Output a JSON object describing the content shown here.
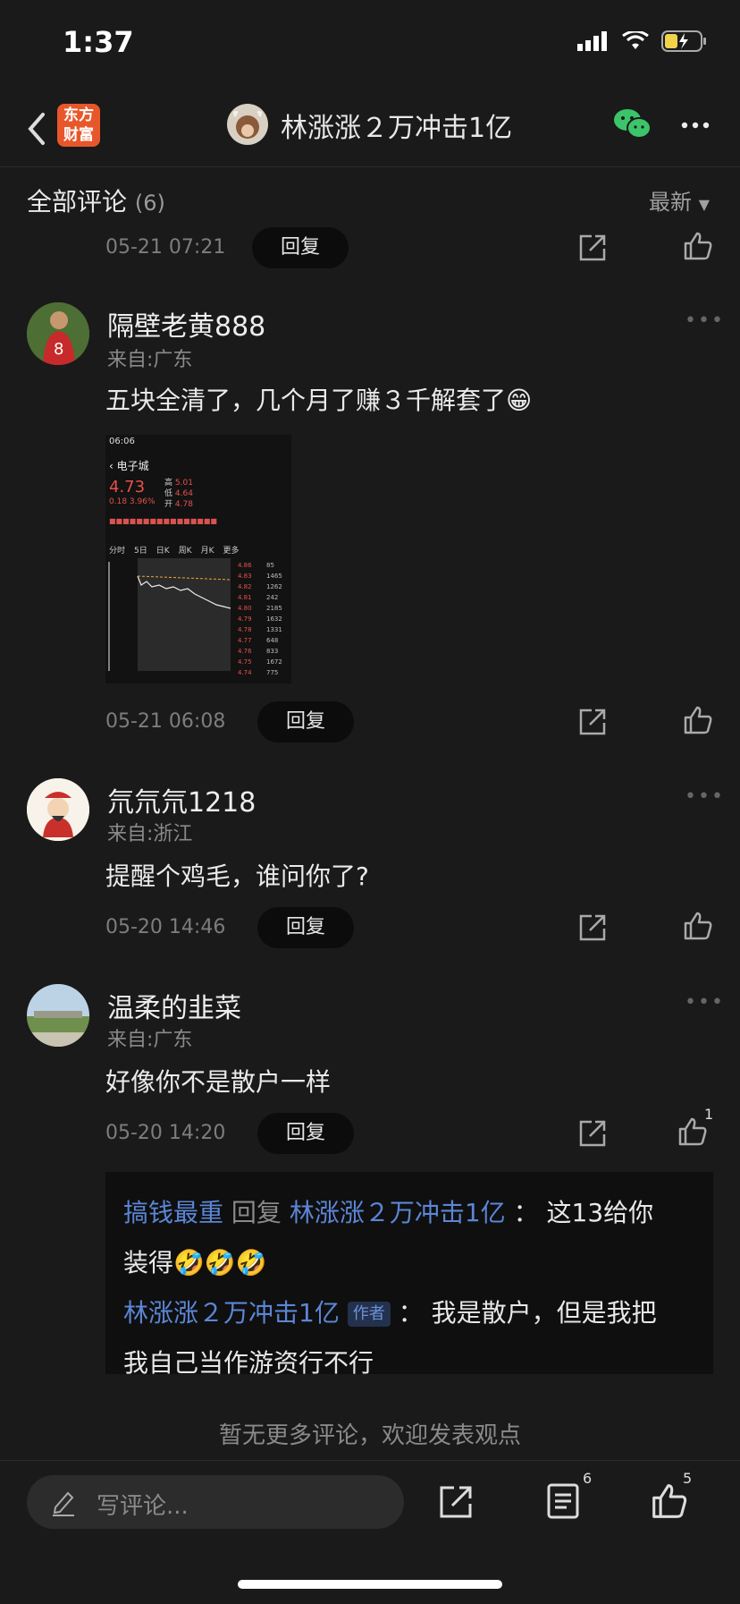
{
  "status": {
    "time": "1:37"
  },
  "nav": {
    "logo_line1": "东方",
    "logo_line2": "财富",
    "title": "林涨涨２万冲击1亿"
  },
  "header": {
    "title": "全部评论",
    "count": "(6)",
    "sort": "最新"
  },
  "top_partial": {
    "time": "05-21 07:21",
    "reply": "回复"
  },
  "comments": [
    {
      "username": "隔壁老黄888",
      "location": "来自:广东",
      "content": "五块全清了，几个月了赚３千解套了😁",
      "time": "05-21 06:08",
      "reply": "回复"
    },
    {
      "username": "氘氘氘1218",
      "location": "来自:浙江",
      "content": "提醒个鸡毛，谁问你了?",
      "time": "05-20 14:46",
      "reply": "回复"
    },
    {
      "username": "温柔的韭菜",
      "location": "来自:广东",
      "content": "好像你不是散户一样",
      "time": "05-20 14:20",
      "reply": "回复",
      "like_count": "1"
    }
  ],
  "replies": [
    {
      "from": "搞钱最重",
      "verb": "回复",
      "to": "林涨涨２万冲击1亿",
      "colon": "：",
      "text1": "这13给你",
      "text2": "装得🤣🤣🤣"
    },
    {
      "from": "林涨涨２万冲击1亿",
      "tag": "作者",
      "colon": "：",
      "text1": "我是散户，但是我把",
      "text2": "我自己当作游资行不行"
    }
  ],
  "chart_image": {
    "title": "电子城",
    "price": "4.73",
    "change": "0.18 3.96%",
    "high": "5.01",
    "low": "4.64",
    "open": "4.78",
    "time": "06:06",
    "tabs": [
      "分时",
      "5日",
      "日K",
      "周K",
      "月K",
      "更多"
    ]
  },
  "footer": {
    "no_more": "暂无更多评论，欢迎发表观点",
    "input_placeholder": "写评论...",
    "comments_badge": "6",
    "likes_badge": "5"
  }
}
